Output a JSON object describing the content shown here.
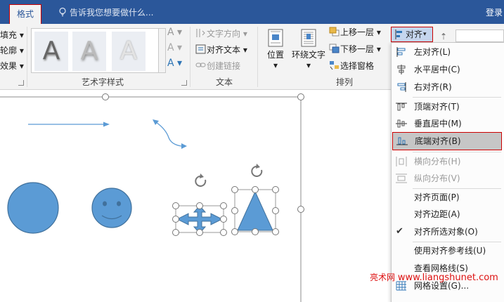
{
  "titlebar": {
    "tab_format": "格式",
    "tell_me": "告诉我您想要做什么...",
    "login": "登录"
  },
  "ribbon": {
    "left_labels": [
      "填充",
      "轮廓",
      "效果"
    ],
    "wordart": {
      "group_label": "艺术字样式",
      "sample_letter": "A",
      "fill_letter": "A",
      "outline_letter": "A",
      "effect_letter": "A"
    },
    "text_group": {
      "group_label": "文本",
      "text_direction": "文字方向",
      "align_text": "对齐文本",
      "create_link": "创建链接"
    },
    "arrange_group": {
      "group_label": "排列",
      "position": "位置",
      "wrap_text": "环绕文字",
      "bring_forward": "上移一层",
      "send_backward": "下移一层",
      "selection_pane": "选择窗格",
      "align": "对齐"
    }
  },
  "align_menu": {
    "items": [
      {
        "label": "左对齐(L)",
        "icon": "align-left-icon"
      },
      {
        "label": "水平居中(C)",
        "icon": "align-center-icon"
      },
      {
        "label": "右对齐(R)",
        "icon": "align-right-icon"
      },
      {
        "label": "顶端对齐(T)",
        "icon": "align-top-icon"
      },
      {
        "label": "垂直居中(M)",
        "icon": "align-middle-icon"
      },
      {
        "label": "底端对齐(B)",
        "icon": "align-bottom-icon"
      },
      {
        "label": "横向分布(H)",
        "icon": "distribute-horizontal-icon"
      },
      {
        "label": "纵向分布(V)",
        "icon": "distribute-vertical-icon"
      },
      {
        "label": "对齐页面(P)",
        "icon": ""
      },
      {
        "label": "对齐边距(A)",
        "icon": ""
      },
      {
        "label": "对齐所选对象(O)",
        "icon": "checkmark-icon"
      },
      {
        "label": "使用对齐参考线(U)",
        "icon": ""
      },
      {
        "label": "查看网格线(S)",
        "icon": ""
      },
      {
        "label": "网格设置(G)...",
        "icon": "grid-icon"
      }
    ]
  },
  "watermark": {
    "cn": "亮术网",
    "url": "www.liangshunet.com"
  },
  "colors": {
    "title_blue": "#2b579a",
    "shape_blue": "#5b9bd5",
    "highlight_red": "#cc0000"
  }
}
